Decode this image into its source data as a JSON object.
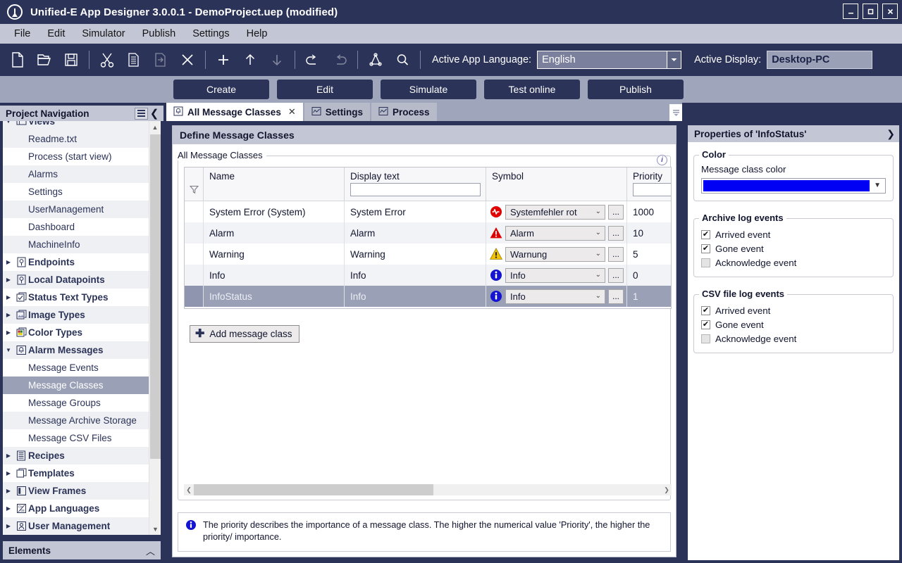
{
  "window": {
    "title": "Unified-E App Designer 3.0.0.1 - DemoProject.uep  (modified)",
    "minimize_label": "_",
    "maximize_label": "□",
    "close_label": "✕"
  },
  "menubar": {
    "items": [
      {
        "label": "File"
      },
      {
        "label": "Edit"
      },
      {
        "label": "Simulator"
      },
      {
        "label": "Publish"
      },
      {
        "label": "Settings"
      },
      {
        "label": "Help"
      }
    ]
  },
  "toolbar": {
    "icons": [
      {
        "name": "new-file-icon",
        "disabled": false
      },
      {
        "name": "open-folder-icon",
        "disabled": false
      },
      {
        "name": "save-icon",
        "disabled": false
      },
      {
        "name": "cut-icon",
        "disabled": false
      },
      {
        "name": "copy-icon",
        "disabled": false
      },
      {
        "name": "paste-icon",
        "disabled": true
      },
      {
        "name": "delete-icon",
        "disabled": false
      },
      {
        "name": "add-icon",
        "disabled": false
      },
      {
        "name": "move-up-icon",
        "disabled": false
      },
      {
        "name": "move-down-icon",
        "disabled": true
      },
      {
        "name": "undo-icon",
        "disabled": false
      },
      {
        "name": "redo-icon",
        "disabled": true
      },
      {
        "name": "diagram-icon",
        "disabled": false
      },
      {
        "name": "search-icon",
        "disabled": false
      }
    ],
    "language_label": "Active App Language:",
    "language_value": "English",
    "display_label": "Active Display:",
    "display_value": "Desktop-PC"
  },
  "actionbar": {
    "buttons": [
      {
        "label": "Create"
      },
      {
        "label": "Edit"
      },
      {
        "label": "Simulate"
      },
      {
        "label": "Test online"
      },
      {
        "label": "Publish"
      }
    ]
  },
  "sidebar": {
    "title": "Project Navigation",
    "elements_title": "Elements",
    "tree": [
      {
        "label": "Views",
        "type": "group",
        "expanded": true,
        "icon": "views-icon",
        "alt": true
      },
      {
        "label": "Readme.txt",
        "type": "child",
        "alt": true
      },
      {
        "label": "Process (start view)",
        "type": "child",
        "alt": false
      },
      {
        "label": "Alarms",
        "type": "child",
        "alt": true
      },
      {
        "label": "Settings",
        "type": "child",
        "alt": false
      },
      {
        "label": "UserManagement",
        "type": "child",
        "alt": true
      },
      {
        "label": "Dashboard",
        "type": "child",
        "alt": false
      },
      {
        "label": "MachineInfo",
        "type": "child",
        "alt": true
      },
      {
        "label": "Endpoints",
        "type": "group",
        "expanded": false,
        "icon": "endpoints-icon",
        "alt": false
      },
      {
        "label": "Local Datapoints",
        "type": "group",
        "expanded": false,
        "icon": "datapoints-icon",
        "alt": true
      },
      {
        "label": "Status Text Types",
        "type": "group",
        "expanded": false,
        "icon": "status-text-icon",
        "alt": false
      },
      {
        "label": "Image Types",
        "type": "group",
        "expanded": false,
        "icon": "image-types-icon",
        "alt": true
      },
      {
        "label": "Color Types",
        "type": "group",
        "expanded": false,
        "icon": "color-types-icon",
        "alt": false
      },
      {
        "label": "Alarm Messages",
        "type": "group",
        "expanded": true,
        "icon": "alarm-messages-icon",
        "alt": true
      },
      {
        "label": "Message Events",
        "type": "child",
        "alt": false
      },
      {
        "label": "Message Classes",
        "type": "child",
        "alt": false,
        "selected": true
      },
      {
        "label": "Message Groups",
        "type": "child",
        "alt": false
      },
      {
        "label": "Message Archive Storage",
        "type": "child",
        "alt": true
      },
      {
        "label": "Message CSV Files",
        "type": "child",
        "alt": false
      },
      {
        "label": "Recipes",
        "type": "group",
        "expanded": false,
        "icon": "recipes-icon",
        "alt": true
      },
      {
        "label": "Templates",
        "type": "group",
        "expanded": false,
        "icon": "templates-icon",
        "alt": false
      },
      {
        "label": "View Frames",
        "type": "group",
        "expanded": false,
        "icon": "view-frames-icon",
        "alt": true
      },
      {
        "label": "App Languages",
        "type": "group",
        "expanded": false,
        "icon": "app-languages-icon",
        "alt": false
      },
      {
        "label": "User Management",
        "type": "group",
        "expanded": false,
        "icon": "user-management-icon",
        "alt": true
      }
    ]
  },
  "tabs": [
    {
      "label": "All Message Classes",
      "icon": "bell-icon",
      "active": true,
      "closable": true,
      "close_label": "✕"
    },
    {
      "label": "Settings",
      "icon": "chart-icon",
      "active": false,
      "closable": false
    },
    {
      "label": "Process",
      "icon": "chart-icon",
      "active": false,
      "closable": false
    }
  ],
  "main": {
    "card_title": "Define Message Classes",
    "group_legend": "All Message Classes",
    "info_badge": "i",
    "columns": [
      {
        "key": "name",
        "label": "Name",
        "has_filter": false,
        "filter_value": ""
      },
      {
        "key": "display",
        "label": "Display text",
        "has_filter": true,
        "filter_value": ""
      },
      {
        "key": "symbol",
        "label": "Symbol",
        "has_filter": false,
        "filter_value": ""
      },
      {
        "key": "priority",
        "label": "Priority",
        "has_filter": true,
        "filter_value": ""
      }
    ],
    "rows": [
      {
        "name": "System Error (System)",
        "display": "System Error",
        "symbol_icon": "system-error-icon",
        "symbol": "Systemfehler rot",
        "priority": "1000",
        "selected": false
      },
      {
        "name": "Alarm",
        "display": "Alarm",
        "symbol_icon": "alarm-icon",
        "symbol": "Alarm",
        "priority": "10",
        "selected": false
      },
      {
        "name": "Warning",
        "display": "Warning",
        "symbol_icon": "warning-icon",
        "symbol": "Warnung",
        "priority": "5",
        "selected": false
      },
      {
        "name": "Info",
        "display": "Info",
        "symbol_icon": "info-icon",
        "symbol": "Info",
        "priority": "0",
        "selected": false
      },
      {
        "name": "InfoStatus",
        "display": "Info",
        "symbol_icon": "info-icon",
        "symbol": "Info",
        "priority": "1",
        "selected": true
      }
    ],
    "ellipsis_label": "...",
    "add_button_label": "Add message class",
    "hint": "The priority describes the importance of a message class. The higher the numerical value 'Priority', the higher the priority/ importance."
  },
  "properties": {
    "title": "Properties of 'InfoStatus'",
    "color_group": "Color",
    "color_field_label": "Message class color",
    "color_value": "#0000f5",
    "archive_group": "Archive log events",
    "archive_events": [
      {
        "label": "Arrived event",
        "checked": true,
        "disabled": false
      },
      {
        "label": "Gone event",
        "checked": true,
        "disabled": false
      },
      {
        "label": "Acknowledge event",
        "checked": false,
        "disabled": true
      }
    ],
    "csv_group": "CSV file log events",
    "csv_events": [
      {
        "label": "Arrived event",
        "checked": true,
        "disabled": false
      },
      {
        "label": "Gone event",
        "checked": true,
        "disabled": false
      },
      {
        "label": "Acknowledge event",
        "checked": false,
        "disabled": true
      }
    ]
  }
}
